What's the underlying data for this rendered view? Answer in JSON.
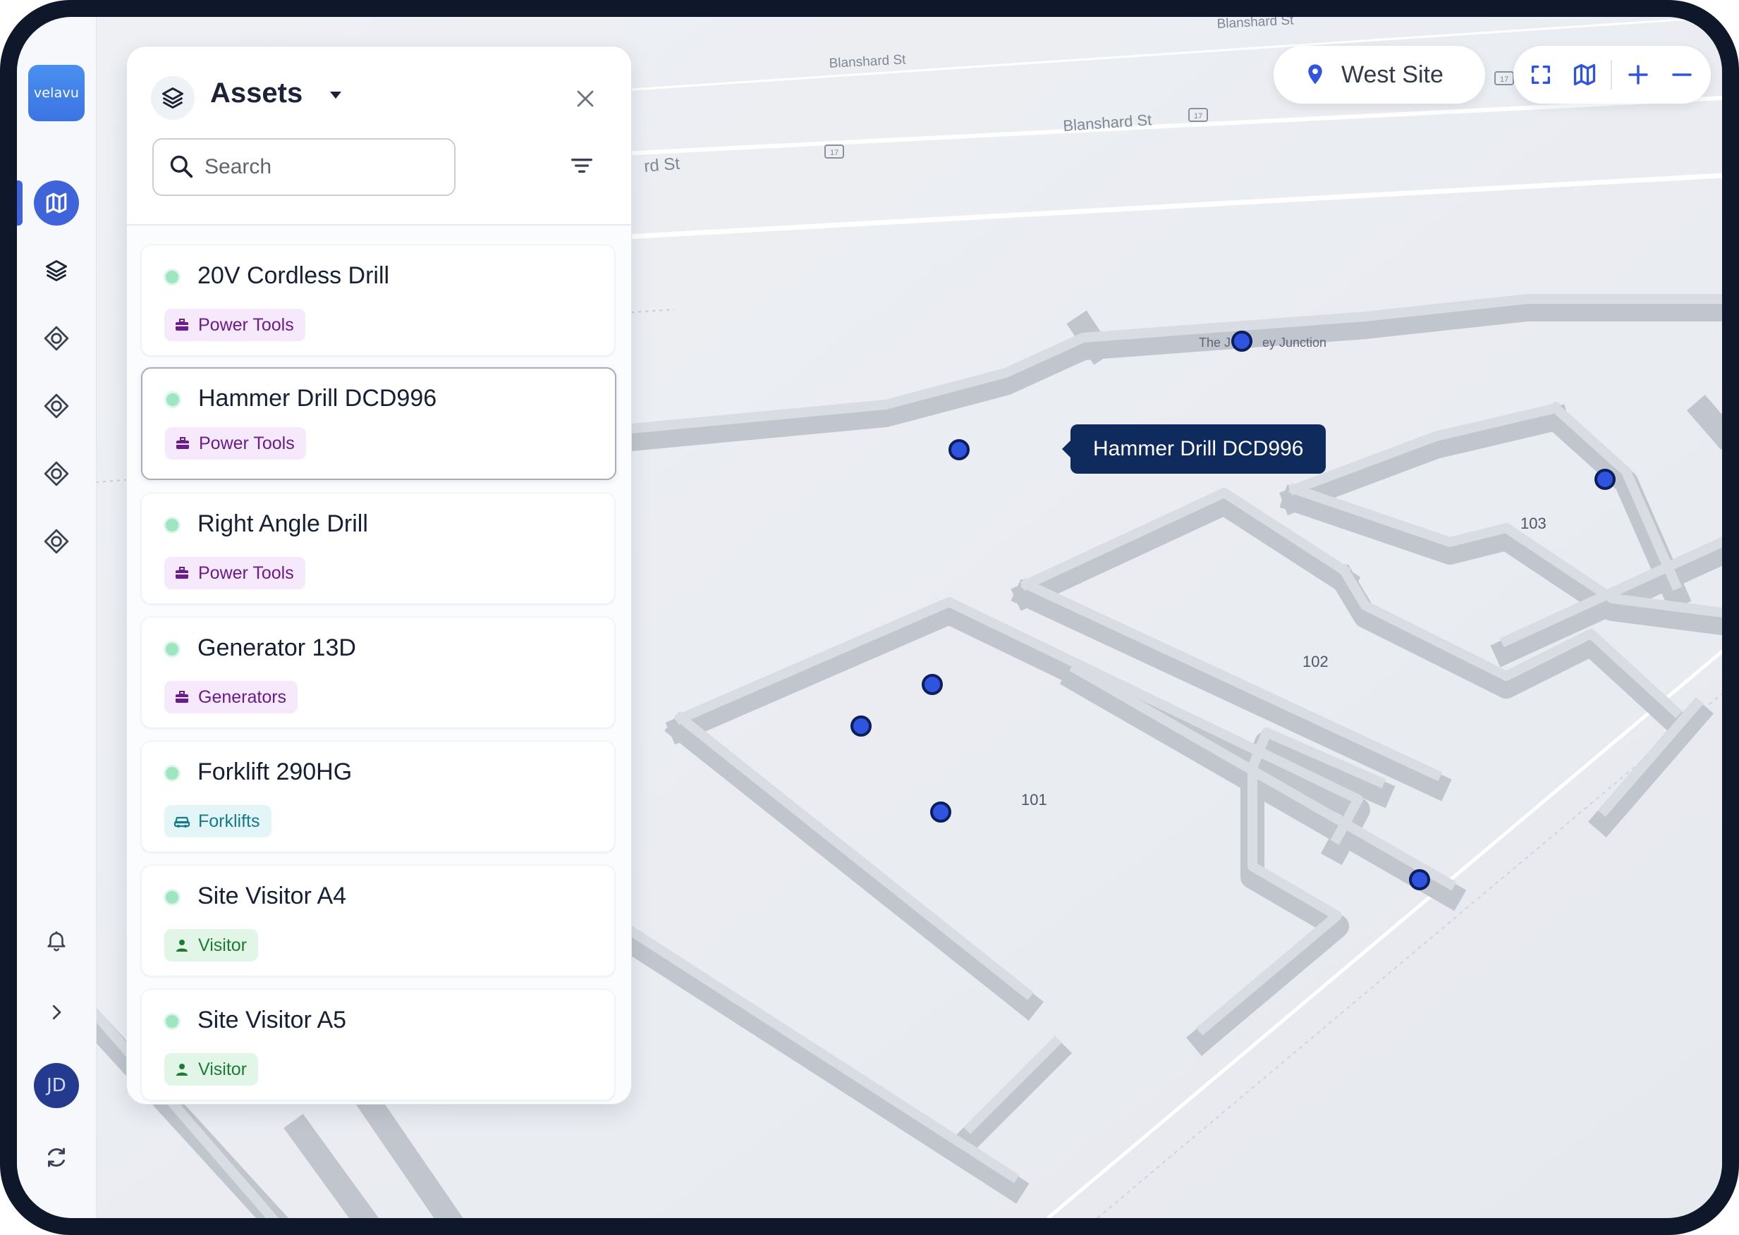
{
  "app": {
    "logo_text": "velavu"
  },
  "rail": {
    "items": [
      {
        "name": "map-icon",
        "active": true
      },
      {
        "name": "layers-icon",
        "active": false
      },
      {
        "name": "geofence-icon",
        "active": false
      },
      {
        "name": "geofence-icon",
        "active": false
      },
      {
        "name": "geofence-icon",
        "active": false
      },
      {
        "name": "geofence-icon",
        "active": false
      }
    ],
    "bottom": [
      "bell-icon",
      "chevron-right-icon"
    ],
    "avatar_initials": "JD",
    "sync_icon": "sync-icon"
  },
  "panel": {
    "title": "Assets",
    "search_placeholder": "Search",
    "items": [
      {
        "title": "20V Cordless Drill",
        "tag": "Power Tools",
        "tag_style": "purple",
        "tag_icon": "toolbox-icon"
      },
      {
        "title": "Hammer Drill DCD996",
        "tag": "Power Tools",
        "tag_style": "purple",
        "tag_icon": "toolbox-icon",
        "selected": true
      },
      {
        "title": "Right Angle Drill",
        "tag": "Power Tools",
        "tag_style": "purple",
        "tag_icon": "toolbox-icon"
      },
      {
        "title": "Generator 13D",
        "tag": "Generators",
        "tag_style": "purple",
        "tag_icon": "toolbox-icon"
      },
      {
        "title": "Forklift 290HG",
        "tag": "Forklifts",
        "tag_style": "teal",
        "tag_icon": "vehicle-icon"
      },
      {
        "title": "Site Visitor A4",
        "tag": "Visitor",
        "tag_style": "green",
        "tag_icon": "person-icon"
      },
      {
        "title": "Site Visitor A5",
        "tag": "Visitor",
        "tag_style": "green",
        "tag_icon": "person-icon"
      }
    ]
  },
  "site_selector": {
    "label": "West Site"
  },
  "map": {
    "tooltip": "Hammer Drill DCD996",
    "street_labels": [
      "Blanshard St",
      "Blanshard St",
      "Blanshard St",
      "rd St"
    ],
    "route_markers": [
      "17",
      "17",
      "17"
    ],
    "poi_left": "The J",
    "poi_right": "ey Junction",
    "rooms": [
      "101",
      "102",
      "103"
    ]
  },
  "colors": {
    "accent": "#3f63d8",
    "tooltip_bg": "#0f2a5c",
    "marker_fill": "#2f54e0",
    "marker_stroke": "#0c1f5a",
    "status_online": "#9ee5c2"
  }
}
